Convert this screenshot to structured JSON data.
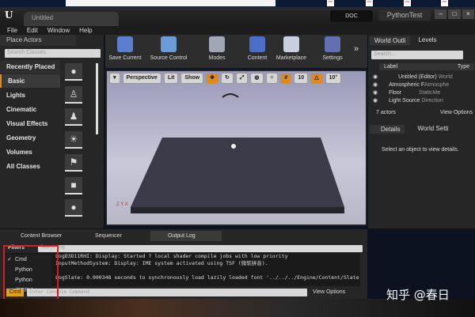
{
  "window": {
    "tab_title": "Untitled",
    "doc_label": "DOC",
    "project_name": "PythonTest",
    "controls": [
      "–",
      "□",
      "×"
    ]
  },
  "menu": [
    "File",
    "Edit",
    "Window",
    "Help"
  ],
  "place_actors": {
    "tab": "Place Actors",
    "search_placeholder": "Search Classes",
    "categories": [
      "Recently Placed",
      "Basic",
      "Lights",
      "Cinematic",
      "Visual Effects",
      "Geometry",
      "Volumes",
      "All Classes"
    ],
    "selected": "Basic"
  },
  "toolbar": [
    "Save Current",
    "Source Control",
    "Modes",
    "Content",
    "Marketplace",
    "Settings"
  ],
  "viewport": {
    "perspective": "Perspective",
    "lit": "Lit",
    "show": "Show",
    "grid_snap": "10",
    "rot_snap": "10°"
  },
  "outliner": {
    "tab": "World Outli",
    "tab2": "Levels",
    "search_placeholder": "Search...",
    "col_label": "Label",
    "col_type": "Type",
    "rows": [
      {
        "label": "Untitled (Editor)",
        "type": "World"
      },
      {
        "label": "Atmospheric F",
        "type": "Atmosphe"
      },
      {
        "label": "Floor",
        "type": "StaticMe"
      },
      {
        "label": "Light Source",
        "type": "Direction"
      }
    ],
    "count": "7 actors",
    "view_options": "View Options"
  },
  "details": {
    "tab": "Details",
    "tab2": "World Setti",
    "empty": "Select an object to view details."
  },
  "bottom": {
    "tabs": [
      "Content Browser",
      "Sequencer",
      "Output Log"
    ],
    "filters": "Filters",
    "search_placeholder": "Search Log",
    "log": [
      "LogD3D11RHI: Display: Started ? local shader compile jobs with low priority",
      "InputMethodSystem: Display: IME system activated using TSF (微软拼音).",
      "",
      "LogSlate: 0.000348 seconds to synchronously load lazily loaded font '../../../Engine/Content/Slate"
    ],
    "menu": [
      "Cmd",
      "Python",
      "Python (REPL)"
    ],
    "menu_checked": "✓",
    "cmd": "Cmd",
    "console_placeholder": "Enter Console Command",
    "view_options": "View Options"
  },
  "watermark": "知乎 @春日",
  "colors": {
    "accent": "#e08a1e",
    "highlight": "#d62020"
  }
}
